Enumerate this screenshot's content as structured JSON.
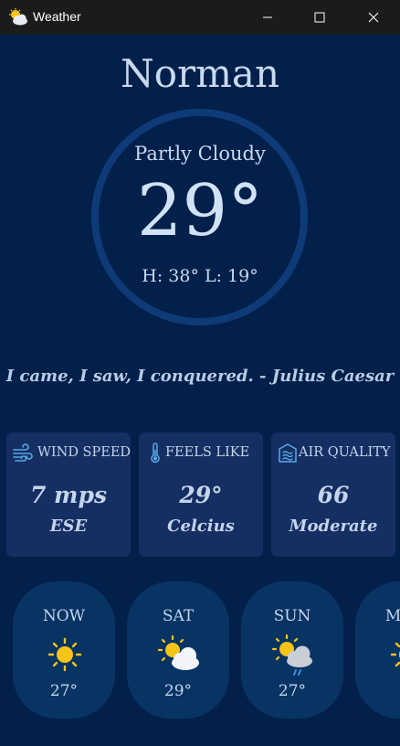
{
  "window": {
    "title": "Weather"
  },
  "location": {
    "city": "Norman"
  },
  "current": {
    "condition": "Partly Cloudy",
    "temperature": "29°",
    "hilo": "H: 38°  L: 19°"
  },
  "quote": "I came, I saw, I conquered. - Julius Caesar",
  "cards": [
    {
      "title": "WIND SPEED",
      "value": "7 mps",
      "sub": "ESE",
      "icon": "wind-icon"
    },
    {
      "title": "FEELS LIKE",
      "value": "29°",
      "sub": "Celcius",
      "icon": "thermometer-icon"
    },
    {
      "title": "AIR QUALITY",
      "value": "66",
      "sub": "Moderate",
      "icon": "air-quality-icon"
    }
  ],
  "forecast": [
    {
      "day": "NOW",
      "temp": "27°",
      "icon": "sun-icon"
    },
    {
      "day": "SAT",
      "temp": "29°",
      "icon": "partly-cloudy-icon"
    },
    {
      "day": "SUN",
      "temp": "27°",
      "icon": "rain-cloud-icon"
    },
    {
      "day": "MON",
      "temp": "",
      "icon": "sun-icon"
    }
  ],
  "colors": {
    "background": "#03204a",
    "card": "#152f63",
    "forecast_card": "#083464",
    "ring": "#0e3b77",
    "sun": "#f6c416",
    "titlebar": "#1b1b1b"
  }
}
